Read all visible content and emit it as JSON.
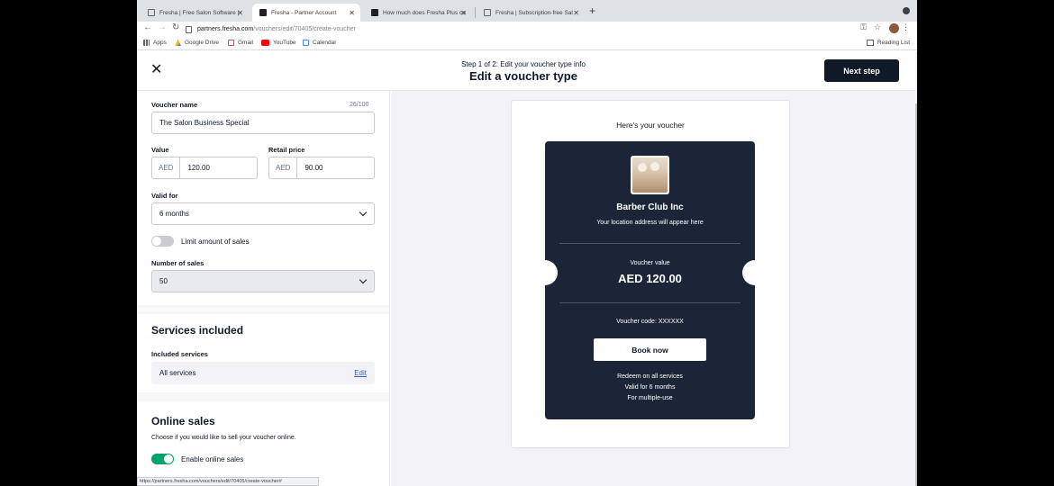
{
  "browser": {
    "tabs": [
      {
        "title": "Fresha | Free Salon Software |"
      },
      {
        "title": "Fresha - Partner Account"
      },
      {
        "title": "How much does Fresha Plus co"
      },
      {
        "title": "Fresha | Subscription-free Sal"
      }
    ],
    "url_host": "partners.fresha.com",
    "url_path": "/vouchers/edit/70405/create-voucher",
    "bookmarks": [
      "Apps",
      "Google Drive",
      "Gmail",
      "YouTube",
      "Calendar"
    ],
    "reading_list": "Reading List",
    "status_url": "https://partners.fresha.com/vouchers/edit/70405/create-voucher#"
  },
  "header": {
    "step": "Step 1 of 2: Edit your voucher type info",
    "title": "Edit a voucher type",
    "next_label": "Next step"
  },
  "form": {
    "voucher_name_label": "Voucher name",
    "voucher_name_counter": "26/100",
    "voucher_name_value": "The Salon Business Special",
    "value_label": "Value",
    "value_currency": "AED",
    "value_amount": "120.00",
    "retail_label": "Retail price",
    "retail_currency": "AED",
    "retail_amount": "90.00",
    "valid_for_label": "Valid for",
    "valid_for_value": "6 months",
    "limit_label": "Limit amount of sales",
    "limit_enabled": false,
    "num_sales_label": "Number of sales",
    "num_sales_value": "50",
    "services_heading": "Services included",
    "included_services_label": "Included services",
    "services_value": "All services",
    "edit_label": "Edit",
    "online_heading": "Online sales",
    "online_desc": "Choose if you would like to sell your voucher online.",
    "online_label": "Enable online sales",
    "online_enabled": true
  },
  "preview": {
    "title": "Here's your voucher",
    "business_name": "Barber Club Inc",
    "address": "Your location address will appear here",
    "value_label": "Voucher value",
    "value": "AED 120.00",
    "code": "Voucher code: XXXXXX",
    "book_label": "Book now",
    "redeem": "Redeem on all services",
    "valid": "Valid for 6 months",
    "use": "For multiple-use"
  },
  "colors": {
    "primary_dark": "#101928",
    "voucher_bg": "#1b2537",
    "toggle_on": "#00a36c",
    "toggle_off": "#c8ccd1",
    "link": "#2d5fdb"
  }
}
